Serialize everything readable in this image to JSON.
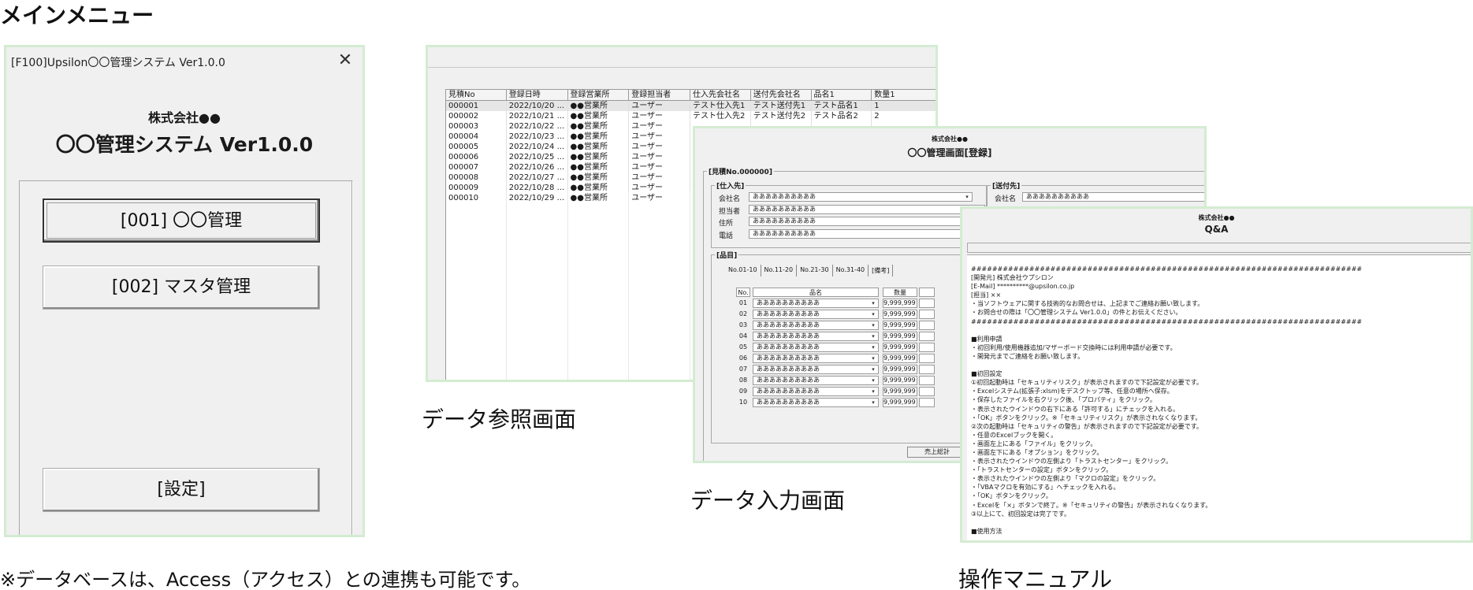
{
  "captions": {
    "main_menu": "メインメニュー",
    "data_view": "データ参照画面",
    "data_input": "データ入力画面",
    "manual": "操作マニュアル",
    "note": "※データベースは、Access（アクセス）との連携も可能です。"
  },
  "menu": {
    "window_title": "[F100]Upsilon〇〇管理システム Ver1.0.0",
    "close_glyph": "✕",
    "company": "株式会社●●",
    "system_name": "〇〇管理システム Ver1.0.0",
    "buttons": {
      "b1": "[001] 〇〇管理",
      "b2": "[002] マスタ管理",
      "settings": "[設定]"
    }
  },
  "data_view": {
    "columns": [
      "見積No",
      "登録日時",
      "登録営業所",
      "登録担当者",
      "仕入先会社名",
      "送付先会社名",
      "品名1",
      "数量1"
    ],
    "rows": [
      [
        "000001",
        "2022/10/20 ...",
        "●●営業所",
        "ユーザー",
        "テスト仕入先1",
        "テスト送付先1",
        "テスト品名1",
        "1"
      ],
      [
        "000002",
        "2022/10/21 ...",
        "●●営業所",
        "ユーザー",
        "テスト仕入先2",
        "テスト送付先2",
        "テスト品名2",
        "2"
      ],
      [
        "000003",
        "2022/10/22 ...",
        "●●営業所",
        "ユーザー",
        "",
        "",
        "",
        ""
      ],
      [
        "000004",
        "2022/10/23 ...",
        "●●営業所",
        "ユーザー",
        "",
        "",
        "",
        ""
      ],
      [
        "000005",
        "2022/10/24 ...",
        "●●営業所",
        "ユーザー",
        "",
        "",
        "",
        ""
      ],
      [
        "000006",
        "2022/10/25 ...",
        "●●営業所",
        "ユーザー",
        "",
        "",
        "",
        ""
      ],
      [
        "000007",
        "2022/10/26 ...",
        "●●営業所",
        "ユーザー",
        "",
        "",
        "",
        ""
      ],
      [
        "000008",
        "2022/10/27 ...",
        "●●営業所",
        "ユーザー",
        "",
        "",
        "",
        ""
      ],
      [
        "000009",
        "2022/10/28 ...",
        "●●営業所",
        "ユーザー",
        "",
        "",
        "",
        ""
      ],
      [
        "000010",
        "2022/10/29 ...",
        "●●営業所",
        "ユーザー",
        "",
        "",
        "",
        ""
      ]
    ]
  },
  "data_input": {
    "company": "株式会社●●",
    "title": "〇〇管理画面[登録]",
    "estimate_frame": "[見積No.000000]",
    "supplier_frame": "[仕入先]",
    "destination_frame": "[送付先]",
    "items_frame": "[品目]",
    "supplier": {
      "company_label": "会社名",
      "company_value": "ああああああああああ",
      "person_label": "担当者",
      "person_value": "ああああああああああ",
      "address_label": "住所",
      "address_value": "ああああああああああ",
      "phone_label": "電話",
      "phone_value": "ああああああああああ"
    },
    "destination": {
      "company_label": "会社名",
      "company_value": "ああああああああああ"
    },
    "tabs": [
      "No.01-10",
      "No.11-20",
      "No.21-30",
      "No.31-40",
      "[備考]"
    ],
    "item_headers": {
      "no": "No.",
      "name": "品名",
      "qty": "数量"
    },
    "items": [
      {
        "no": "01",
        "name": "ああああああああああ",
        "qty": "9,999,999"
      },
      {
        "no": "02",
        "name": "ああああああああああ",
        "qty": "9,999,999"
      },
      {
        "no": "03",
        "name": "ああああああああああ",
        "qty": "9,999,999"
      },
      {
        "no": "04",
        "name": "ああああああああああ",
        "qty": "9,999,999"
      },
      {
        "no": "05",
        "name": "ああああああああああ",
        "qty": "9,999,999"
      },
      {
        "no": "06",
        "name": "ああああああああああ",
        "qty": "9,999,999"
      },
      {
        "no": "07",
        "name": "ああああああああああ",
        "qty": "9,999,999"
      },
      {
        "no": "08",
        "name": "ああああああああああ",
        "qty": "9,999,999"
      },
      {
        "no": "09",
        "name": "ああああああああああ",
        "qty": "9,999,999"
      },
      {
        "no": "10",
        "name": "ああああああああああ",
        "qty": "9,999,999"
      }
    ],
    "sales_button": "売上総計"
  },
  "manual": {
    "company": "株式会社●●",
    "title": "Q&A",
    "lines": [
      "##########################################################################",
      "[開発元] 株式会社ウプシロン",
      "[E-Mail] **********@upsilon.co.jp",
      "[担当] ××",
      "・当ソフトウェアに関する技術的なお問合せは、上記までご連絡お願い致します。",
      "・お問合せの際は「〇〇管理システム Ver1.0.0」の件とお伝えください。",
      "##########################################################################",
      "",
      "■利用申請",
      "・初回利用/使用機器追加/マザーボード交換時には利用申請が必要です。",
      "・開発元までご連絡をお願い致します。",
      "",
      "■初回設定",
      "①初回起動時は「セキュリティリスク」が表示されますので下記設定が必要です。",
      "・Excelシステム(拡張子:xlsm)をデスクトップ等、任意の場所へ保存。",
      "・保存したファイルを右クリック後、「プロパティ」をクリック。",
      "・表示されたウインドウの右下にある「許可する」にチェックを入れる。",
      "・「OK」ボタンをクリック。※「セキュリティリスク」が表示されなくなります。",
      "②次の起動時は「セキュリティの警告」が表示されますので下記設定が必要です。",
      "・任意のExcelブックを開く。",
      "・画面左上にある「ファイル」をクリック。",
      "・画面左下にある「オプション」をクリック。",
      "・表示されたウインドウの左側より「トラストセンター」をクリック。",
      "・「トラストセンターの設定」ボタンをクリック。",
      "・表示されたウインドウの左側より「マクロの設定」をクリック。",
      "・「VBAマクロを有効にする」へチェックを入れる。",
      "・「OK」ボタンをクリック。",
      "・Excelを「×」ボタンで終了。※「セキュリティの警告」が表示されなくなります。",
      "③以上にて、初回設定は完了です。",
      "",
      "■使用方法"
    ]
  }
}
